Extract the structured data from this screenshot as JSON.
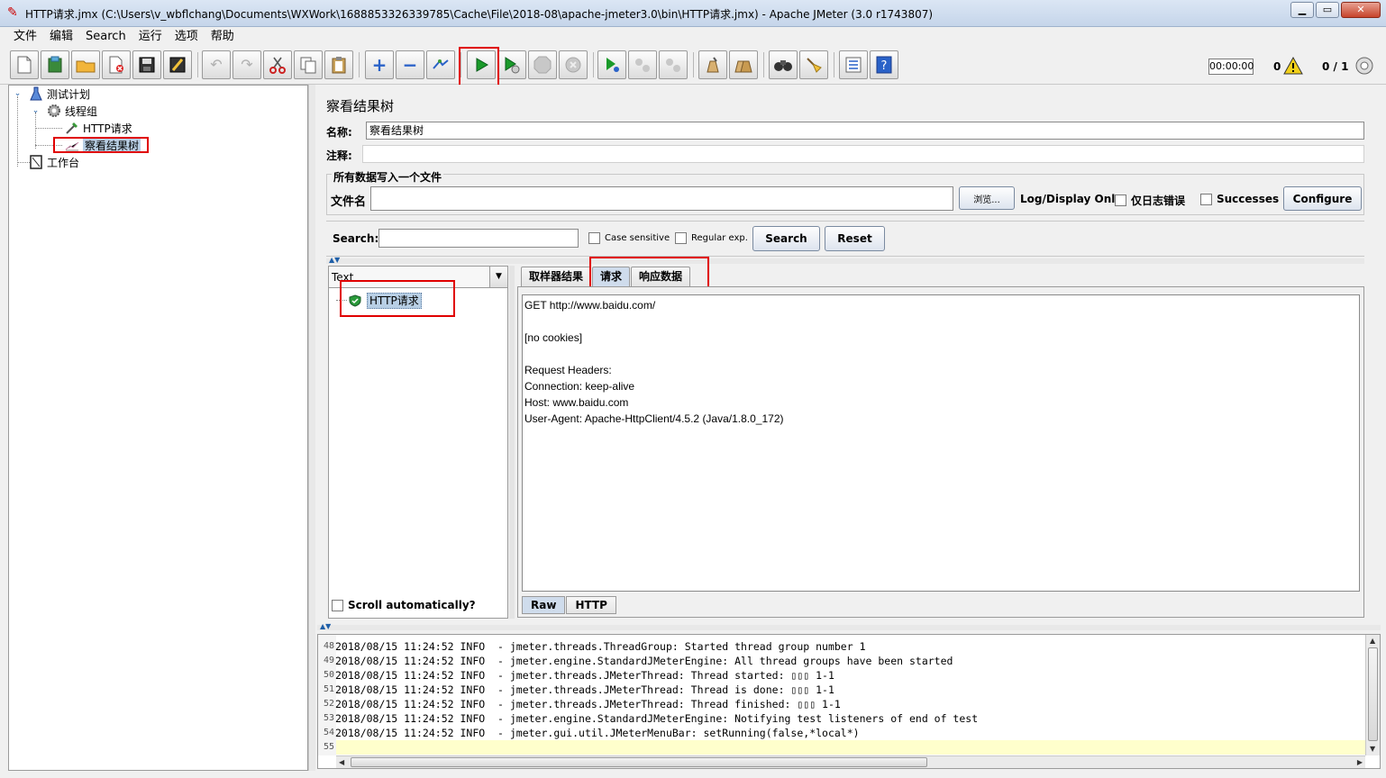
{
  "window": {
    "title": "HTTP请求.jmx (C:\\Users\\v_wbflchang\\Documents\\WXWork\\1688853326339785\\Cache\\File\\2018-08\\apache-jmeter3.0\\bin\\HTTP请求.jmx) - Apache JMeter (3.0 r1743807)",
    "minimize": "▁",
    "maximize": "▭",
    "close": "✕"
  },
  "menu": [
    "文件",
    "编辑",
    "Search",
    "运行",
    "选项",
    "帮助"
  ],
  "toolbar": {
    "timer": "00:00:00",
    "error_count": "0",
    "threads": "0 / 1"
  },
  "tree": {
    "test_plan": "测试计划",
    "thread_group": "线程组",
    "http_request": "HTTP请求",
    "result_tree": "察看结果树",
    "workbench": "工作台"
  },
  "panel": {
    "title": "察看结果树",
    "name_label": "名称:",
    "name_value": "察看结果树",
    "comment_label": "注释:",
    "comment_value": "",
    "file_group": "所有数据写入一个文件",
    "filename_label": "文件名",
    "filename_value": "",
    "browse_button": "浏览...",
    "log_display_label": "Log/Display Only:",
    "errors_only": "仅日志错误",
    "successes": "Successes",
    "configure": "Configure"
  },
  "search": {
    "label": "Search:",
    "value": "",
    "case_sensitive": "Case sensitive",
    "regular_exp": "Regular exp.",
    "search_button": "Search",
    "reset_button": "Reset"
  },
  "results": {
    "renderer": "Text",
    "sample": "HTTP请求",
    "scroll_auto": "Scroll automatically?"
  },
  "tabs": [
    "取样器结果",
    "请求",
    "响应数据"
  ],
  "active_tab": "请求",
  "request_text": [
    "GET http://www.baidu.com/",
    "",
    "[no cookies]",
    "",
    "Request Headers:",
    "Connection: keep-alive",
    "Host: www.baidu.com",
    "User-Agent: Apache-HttpClient/4.5.2 (Java/1.8.0_172)"
  ],
  "subtabs": [
    "Raw",
    "HTTP"
  ],
  "log": [
    {
      "num": "48",
      "text": "2018/08/15 11:24:52 INFO  - jmeter.threads.ThreadGroup: Started thread group number 1"
    },
    {
      "num": "49",
      "text": "2018/08/15 11:24:52 INFO  - jmeter.engine.StandardJMeterEngine: All thread groups have been started"
    },
    {
      "num": "50",
      "text": "2018/08/15 11:24:52 INFO  - jmeter.threads.JMeterThread: Thread started: ▯▯▯ 1-1"
    },
    {
      "num": "51",
      "text": "2018/08/15 11:24:52 INFO  - jmeter.threads.JMeterThread: Thread is done: ▯▯▯ 1-1"
    },
    {
      "num": "52",
      "text": "2018/08/15 11:24:52 INFO  - jmeter.threads.JMeterThread: Thread finished: ▯▯▯ 1-1"
    },
    {
      "num": "53",
      "text": "2018/08/15 11:24:52 INFO  - jmeter.engine.StandardJMeterEngine: Notifying test listeners of end of test"
    },
    {
      "num": "54",
      "text": "2018/08/15 11:24:52 INFO  - jmeter.gui.util.JMeterMenuBar: setRunning(false,*local*)"
    },
    {
      "num": "55",
      "text": ""
    }
  ]
}
